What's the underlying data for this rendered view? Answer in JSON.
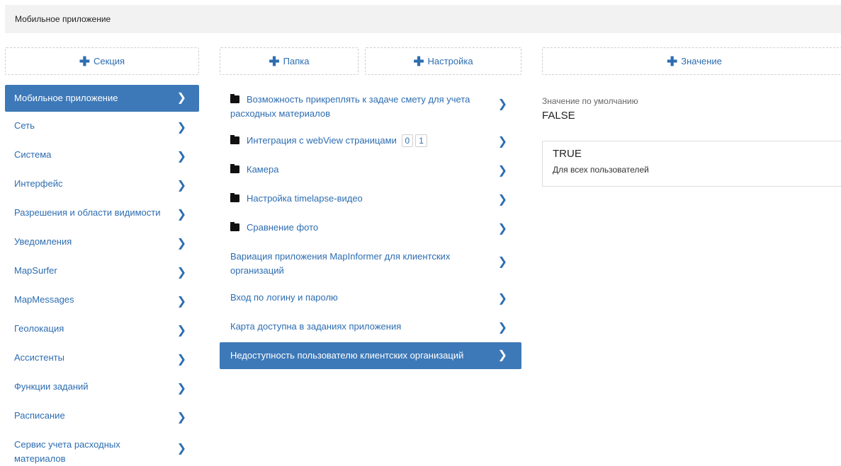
{
  "breadcrumb": {
    "title": "Мобильное приложение"
  },
  "buttons": {
    "section": "Секция",
    "folder": "Папка",
    "setting": "Настройка",
    "value": "Значение"
  },
  "sections": [
    {
      "label": "Мобильное приложение",
      "active": true
    },
    {
      "label": "Сеть"
    },
    {
      "label": "Система"
    },
    {
      "label": "Интерфейс"
    },
    {
      "label": "Разрешения и области видимости"
    },
    {
      "label": "Уведомления"
    },
    {
      "label": "MapSurfer"
    },
    {
      "label": "MapMessages"
    },
    {
      "label": "Геолокация"
    },
    {
      "label": "Ассистенты"
    },
    {
      "label": "Функции заданий"
    },
    {
      "label": "Расписание"
    },
    {
      "label": "Сервис учета расходных материалов"
    }
  ],
  "settings": [
    {
      "label": "Возможность прикреплять к задаче смету для учета расходных материалов",
      "folder": true
    },
    {
      "label": "Интеграция с webView страницами",
      "folder": true,
      "badges": [
        "0",
        "1"
      ]
    },
    {
      "label": "Камера",
      "folder": true
    },
    {
      "label": "Настройка timelapse-видео",
      "folder": true
    },
    {
      "label": "Сравнение фото",
      "folder": true
    },
    {
      "label": "Вариация приложения MapInformer для клиентских организаций"
    },
    {
      "label": "Вход по логину и паролю"
    },
    {
      "label": "Карта доступна в заданиях приложения"
    },
    {
      "label": "Недоступность пользователю клиентских организаций",
      "active": true
    }
  ],
  "detail": {
    "default_label": "Значение по умолчанию",
    "default_value": "FALSE",
    "values": [
      {
        "value": "TRUE",
        "scope": "Для всех пользователей"
      }
    ]
  },
  "colors": {
    "accent": "#3d79b8",
    "link": "#2d6db1"
  },
  "icons": {
    "add": "plus-icon",
    "next": "chevron-right-icon",
    "folder": "folder-icon"
  }
}
